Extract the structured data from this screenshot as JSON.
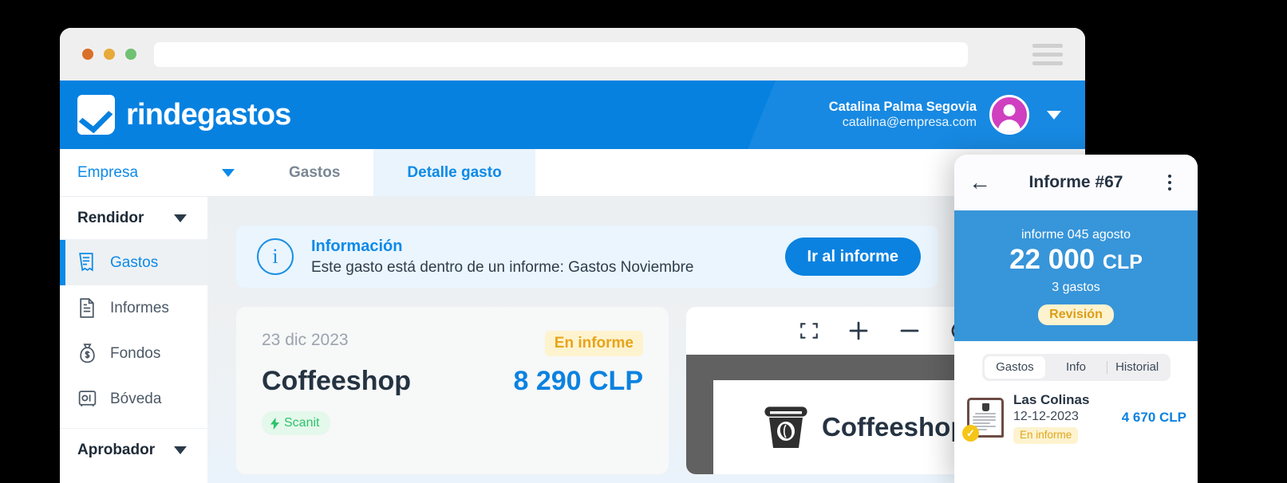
{
  "browser": {
    "traffic_lights": [
      "close",
      "minimize",
      "zoom"
    ],
    "url_value": "",
    "url_placeholder": "",
    "menu_icon": "hamburger-icon"
  },
  "app_header": {
    "brand_name": "rindegastos",
    "brand_icon": "rindegastos-check-logo",
    "user_name": "Catalina Palma Segovia",
    "user_email": "catalina@empresa.com",
    "avatar_icon": "user-avatar-icon",
    "chevron_icon": "chevron-down-icon",
    "bg_color": "#0681e0",
    "avatar_color": "#cf3fc0"
  },
  "nav": {
    "company_label": "Empresa",
    "company_chevron": "chevron-down-icon",
    "tabs": [
      {
        "label": "Gastos",
        "active": false
      },
      {
        "label": "Detalle gasto",
        "active": true
      }
    ]
  },
  "sidebar": {
    "groups": [
      {
        "label": "Rendidor",
        "chevron": "chevron-down-icon"
      },
      {
        "label": "Aprobador",
        "chevron": "chevron-down-icon"
      }
    ],
    "items": [
      {
        "label": "Gastos",
        "icon": "receipt-icon",
        "active": true
      },
      {
        "label": "Informes",
        "icon": "document-icon",
        "active": false
      },
      {
        "label": "Fondos",
        "icon": "money-bag-icon",
        "active": false
      },
      {
        "label": "Bóveda",
        "icon": "safe-vault-icon",
        "active": false
      }
    ]
  },
  "info_banner": {
    "icon": "info-circle-icon",
    "title": "Información",
    "message": "Este gasto está dentro de un informe: Gastos Noviembre",
    "button_label": "Ir al informe",
    "button_color": "#0b82e0"
  },
  "expense_card": {
    "date": "23 dic 2023",
    "status_badge": "En informe",
    "merchant": "Coffeeshop",
    "amount": "8 290 CLP",
    "source_badge": "Scanit",
    "source_icon": "lightning-bolt-icon",
    "amount_color": "#0b82e0",
    "badge_color": "#e8a41b"
  },
  "viewer": {
    "toolbar": [
      {
        "name": "fullscreen-icon",
        "label": "Pantalla completa"
      },
      {
        "name": "zoom-in-icon",
        "label": "+"
      },
      {
        "name": "zoom-out-icon",
        "label": "−"
      },
      {
        "name": "rotate-icon",
        "label": "Rotar"
      }
    ],
    "receipt_brand": "Coffeeshop",
    "receipt_icon": "coffee-cup-icon",
    "stage_color": "#616161"
  },
  "mobile": {
    "back_icon": "arrow-left-icon",
    "title": "Informe #67",
    "kebab_icon": "more-vertical-icon",
    "hero": {
      "label": "informe 045 agosto",
      "amount": "22 000",
      "currency": "CLP",
      "count": "3 gastos",
      "status": "Revisión",
      "bg_color": "#3795d9"
    },
    "tabs": [
      {
        "label": "Gastos",
        "active": true
      },
      {
        "label": "Info",
        "active": false
      },
      {
        "label": "Historial",
        "active": false
      }
    ],
    "list": [
      {
        "thumb_icon": "receipt-thumbnail-icon",
        "check_icon": "check-circle-icon",
        "title": "Las Colinas",
        "date": "12-12-2023",
        "badge": "En informe",
        "amount": "4 670 CLP"
      }
    ]
  }
}
